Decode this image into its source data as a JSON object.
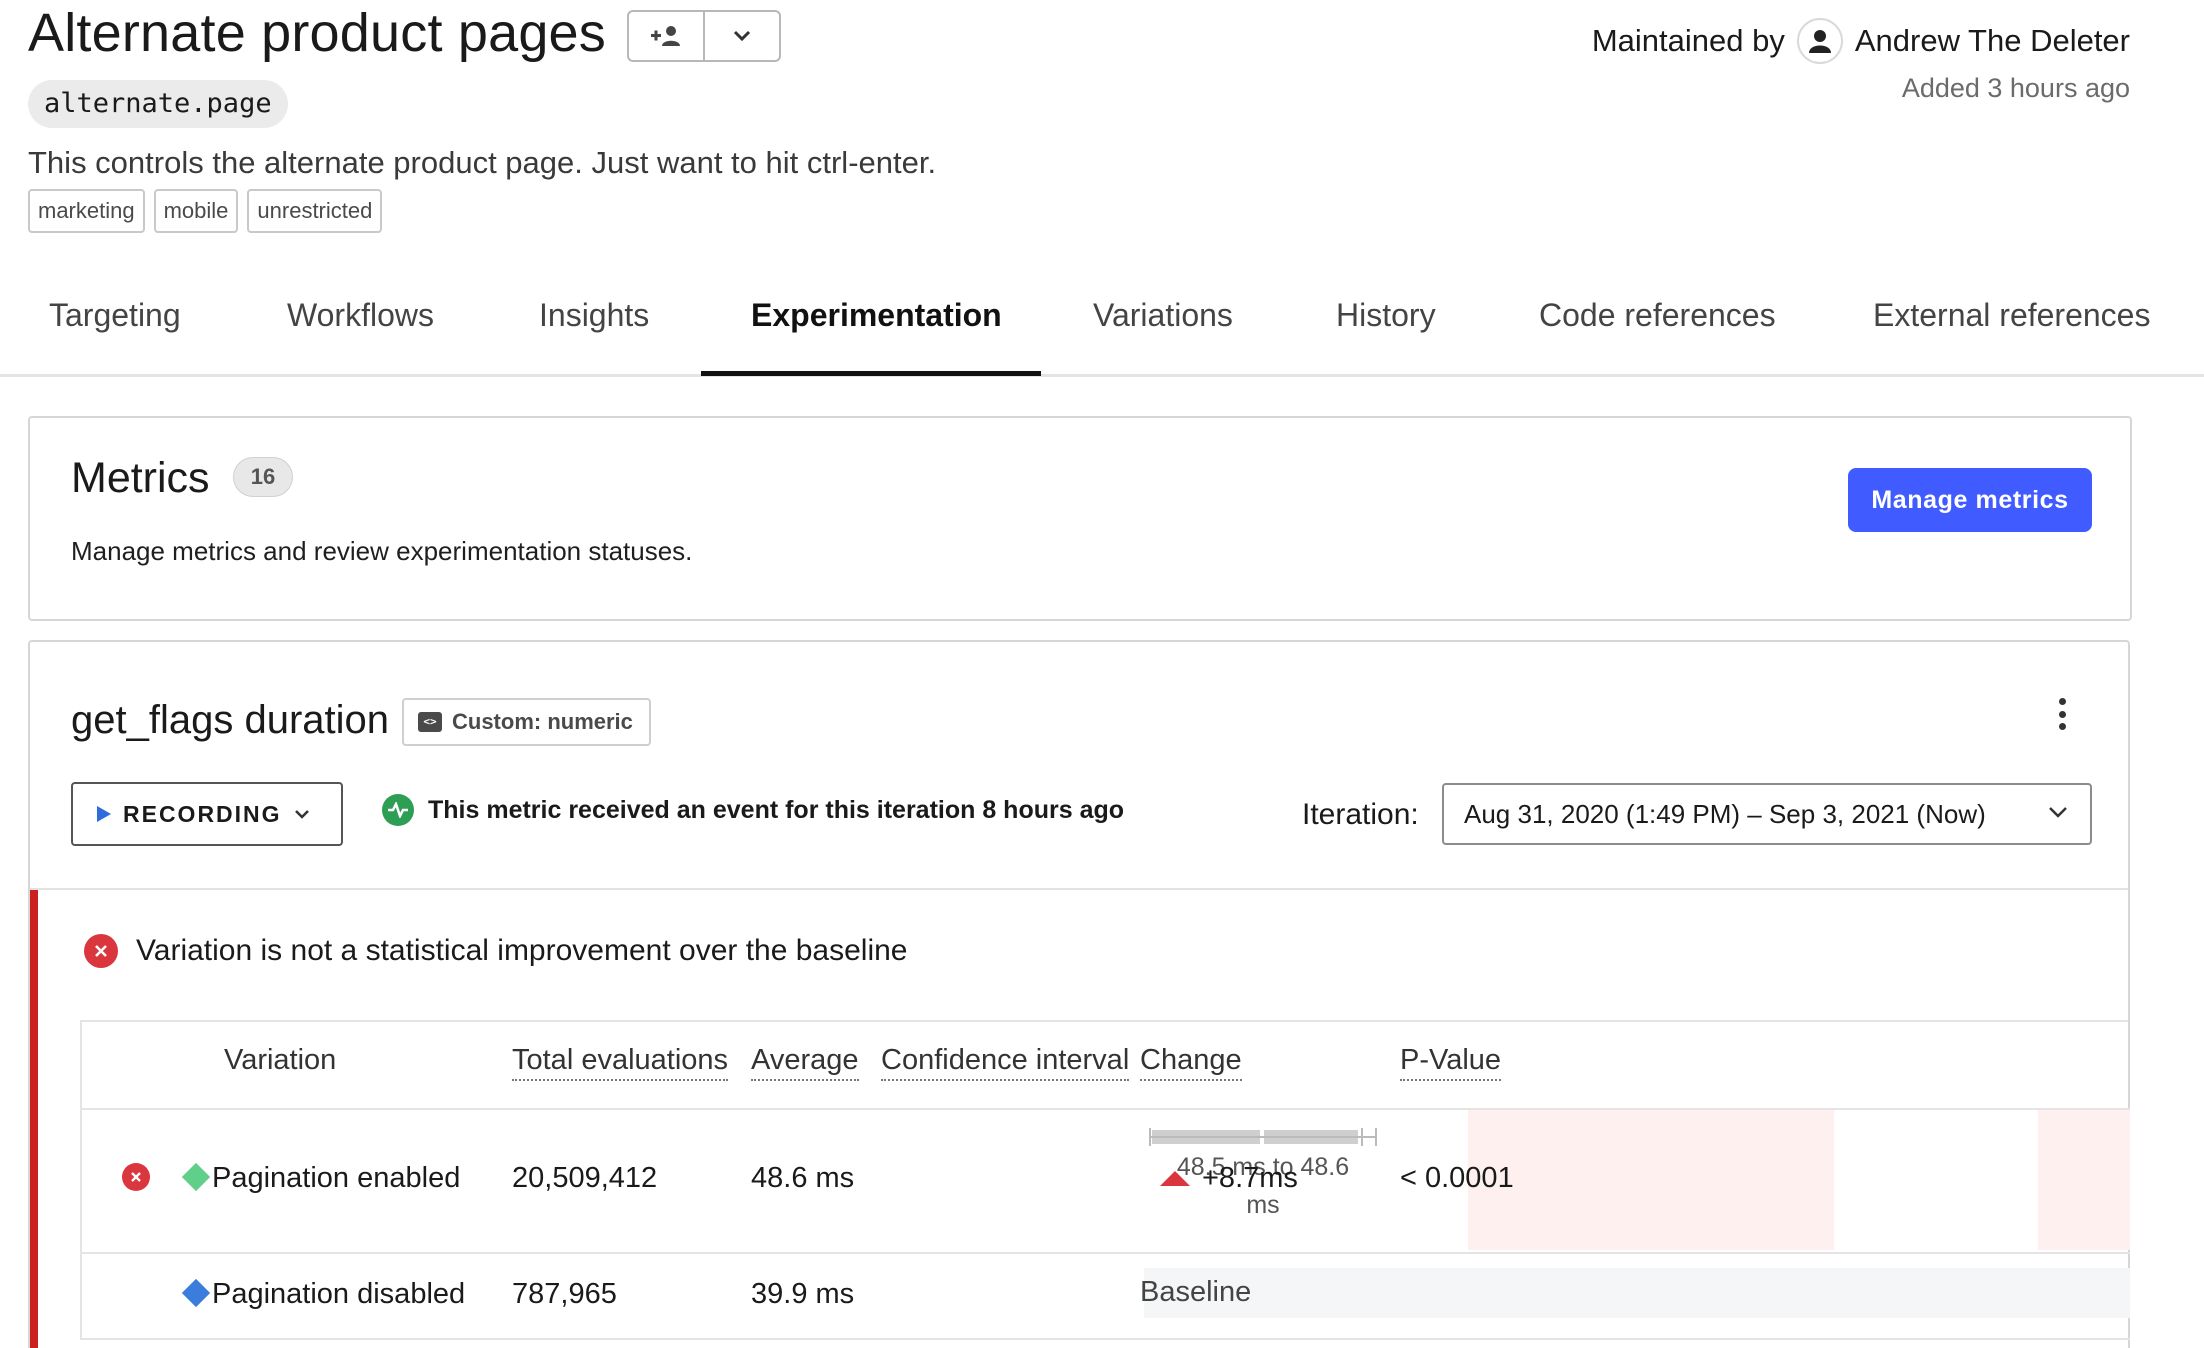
{
  "header": {
    "title": "Alternate product pages",
    "flag_key": "alternate.page",
    "description": "This controls the alternate product page. Just want to hit ctrl-enter.",
    "tags": [
      "marketing",
      "mobile",
      "unrestricted"
    ],
    "maintained_by_label": "Maintained by",
    "maintainer": "Andrew The Deleter",
    "added": "Added 3 hours ago"
  },
  "tabs": [
    {
      "label": "Targeting",
      "active": false
    },
    {
      "label": "Workflows",
      "active": false
    },
    {
      "label": "Insights",
      "active": false
    },
    {
      "label": "Experimentation",
      "active": true
    },
    {
      "label": "Variations",
      "active": false
    },
    {
      "label": "History",
      "active": false
    },
    {
      "label": "Code references",
      "active": false
    },
    {
      "label": "External references",
      "active": false
    }
  ],
  "metrics": {
    "title": "Metrics",
    "count": "16",
    "subtitle": "Manage metrics and review experimentation statuses.",
    "manage_button": "Manage metrics"
  },
  "metric": {
    "name": "get_flags duration",
    "type": "Custom: numeric",
    "recording_label": "RECORDING",
    "event_status": "This metric received an event for this iteration 8 hours ago",
    "iteration_label": "Iteration:",
    "iteration_value": "Aug 31, 2020 (1:49 PM) – Sep 3, 2021 (Now)",
    "verdict": "Variation is not a statistical improvement over the baseline"
  },
  "table": {
    "headers": {
      "variation": "Variation",
      "total_evaluations": "Total evaluations",
      "average": "Average",
      "confidence_interval": "Confidence interval",
      "change": "Change",
      "p_value": "P-Value"
    },
    "rows": [
      {
        "variation": "Pagination enabled",
        "color": "#5fcf8a",
        "total_evaluations": "20,509,412",
        "average": "48.6 ms",
        "ci_line1": "48.5 ms to 48.6",
        "ci_line2": "ms",
        "change": "+8.7ms",
        "p_value": "< 0.0001"
      },
      {
        "variation": "Pagination disabled",
        "color": "#3b7ddd",
        "total_evaluations": "787,965",
        "average": "39.9 ms",
        "baseline": "Baseline"
      }
    ]
  },
  "colors": {
    "accent": "#405bff",
    "error": "#d9363e",
    "success": "#2e9e55"
  }
}
